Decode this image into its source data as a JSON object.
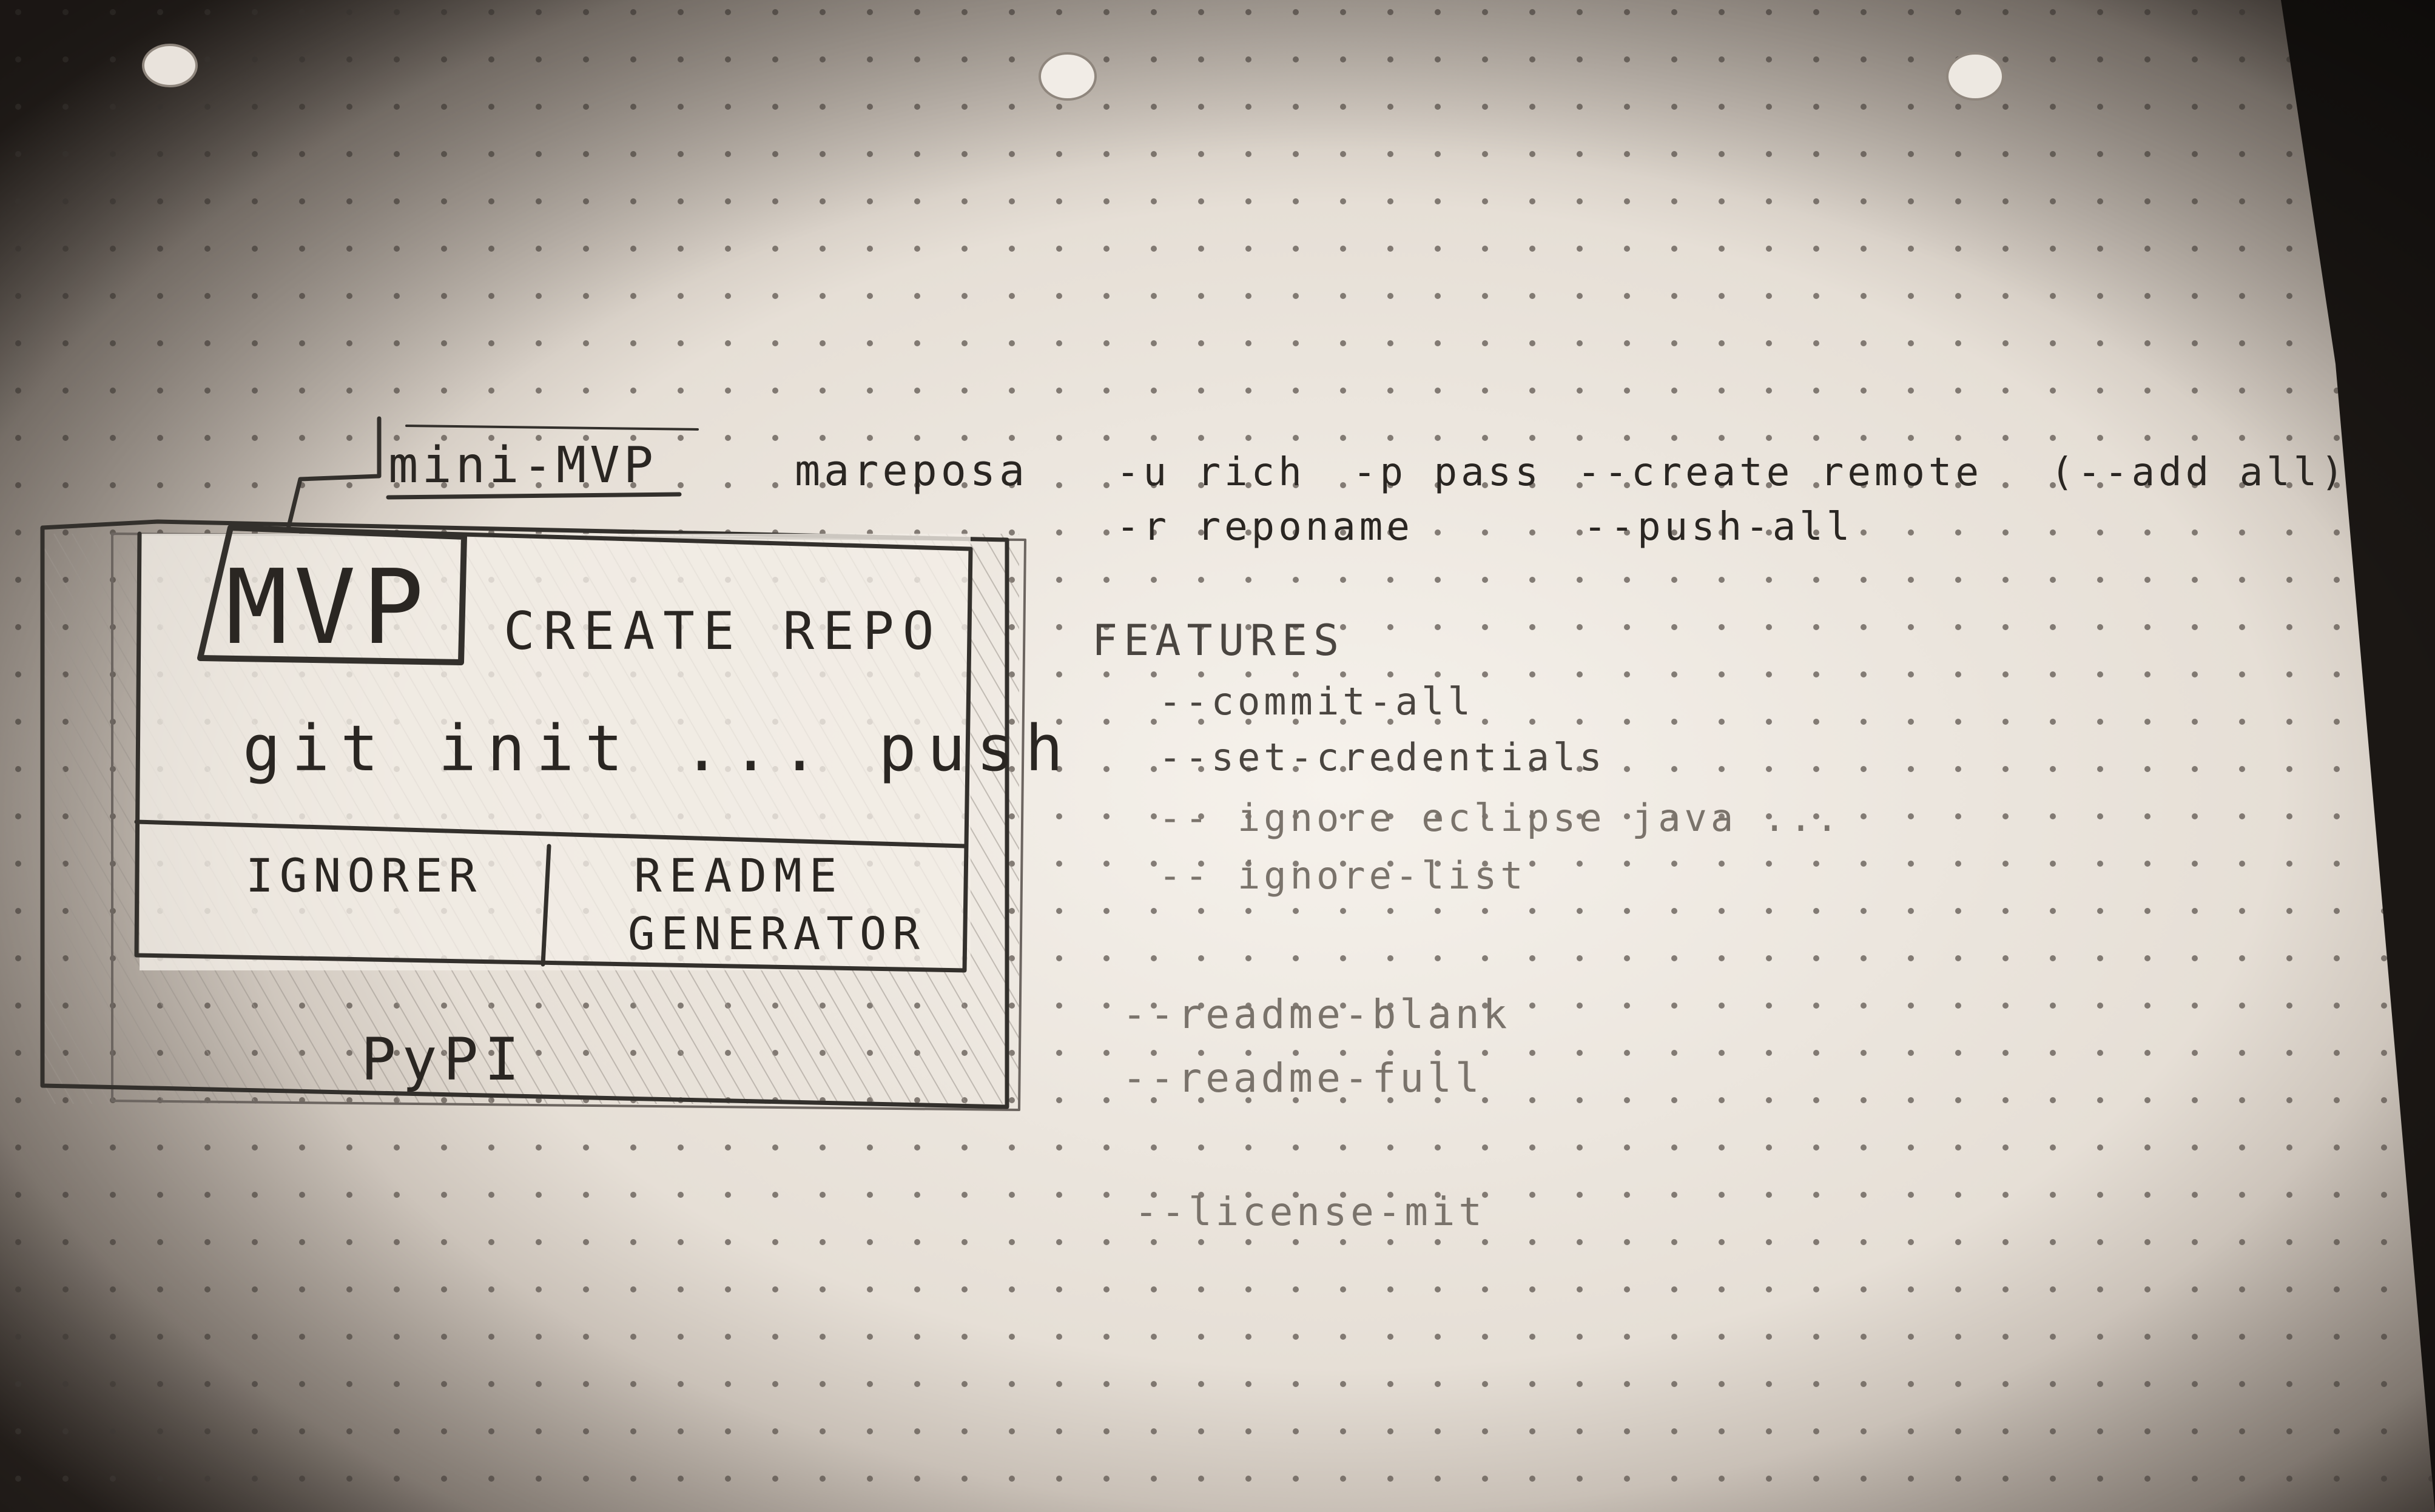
{
  "sketch": {
    "mini_mvp_label": "mini-MVP",
    "mvp_label": "MVP",
    "create_repo_label": "CREATE REPO",
    "git_line": "git init ... push",
    "ignorer_label": "IGNORER",
    "readme_label_line1": "README",
    "readme_label_line2": "GENERATOR",
    "pypi_label": "PyPI"
  },
  "cli": {
    "command": "mareposa",
    "line1": [
      "-u rich",
      "-p pass",
      "--create remote",
      "(--add all)"
    ],
    "line2": [
      "-r reponame",
      "--push-all"
    ]
  },
  "features": {
    "heading": "FEATURES",
    "group1": [
      "--commit-all",
      "--set-credentials",
      "-- ignore eclipse java ...",
      "-- ignore-list"
    ],
    "group2": [
      "--readme-blank",
      "--readme-full"
    ],
    "group3": [
      "--license-mit"
    ]
  },
  "colors": {
    "paper_light": "#f4efe7",
    "paper_dark": "#2a2420",
    "ink": "#33302c",
    "pencil": "#8a837b"
  }
}
